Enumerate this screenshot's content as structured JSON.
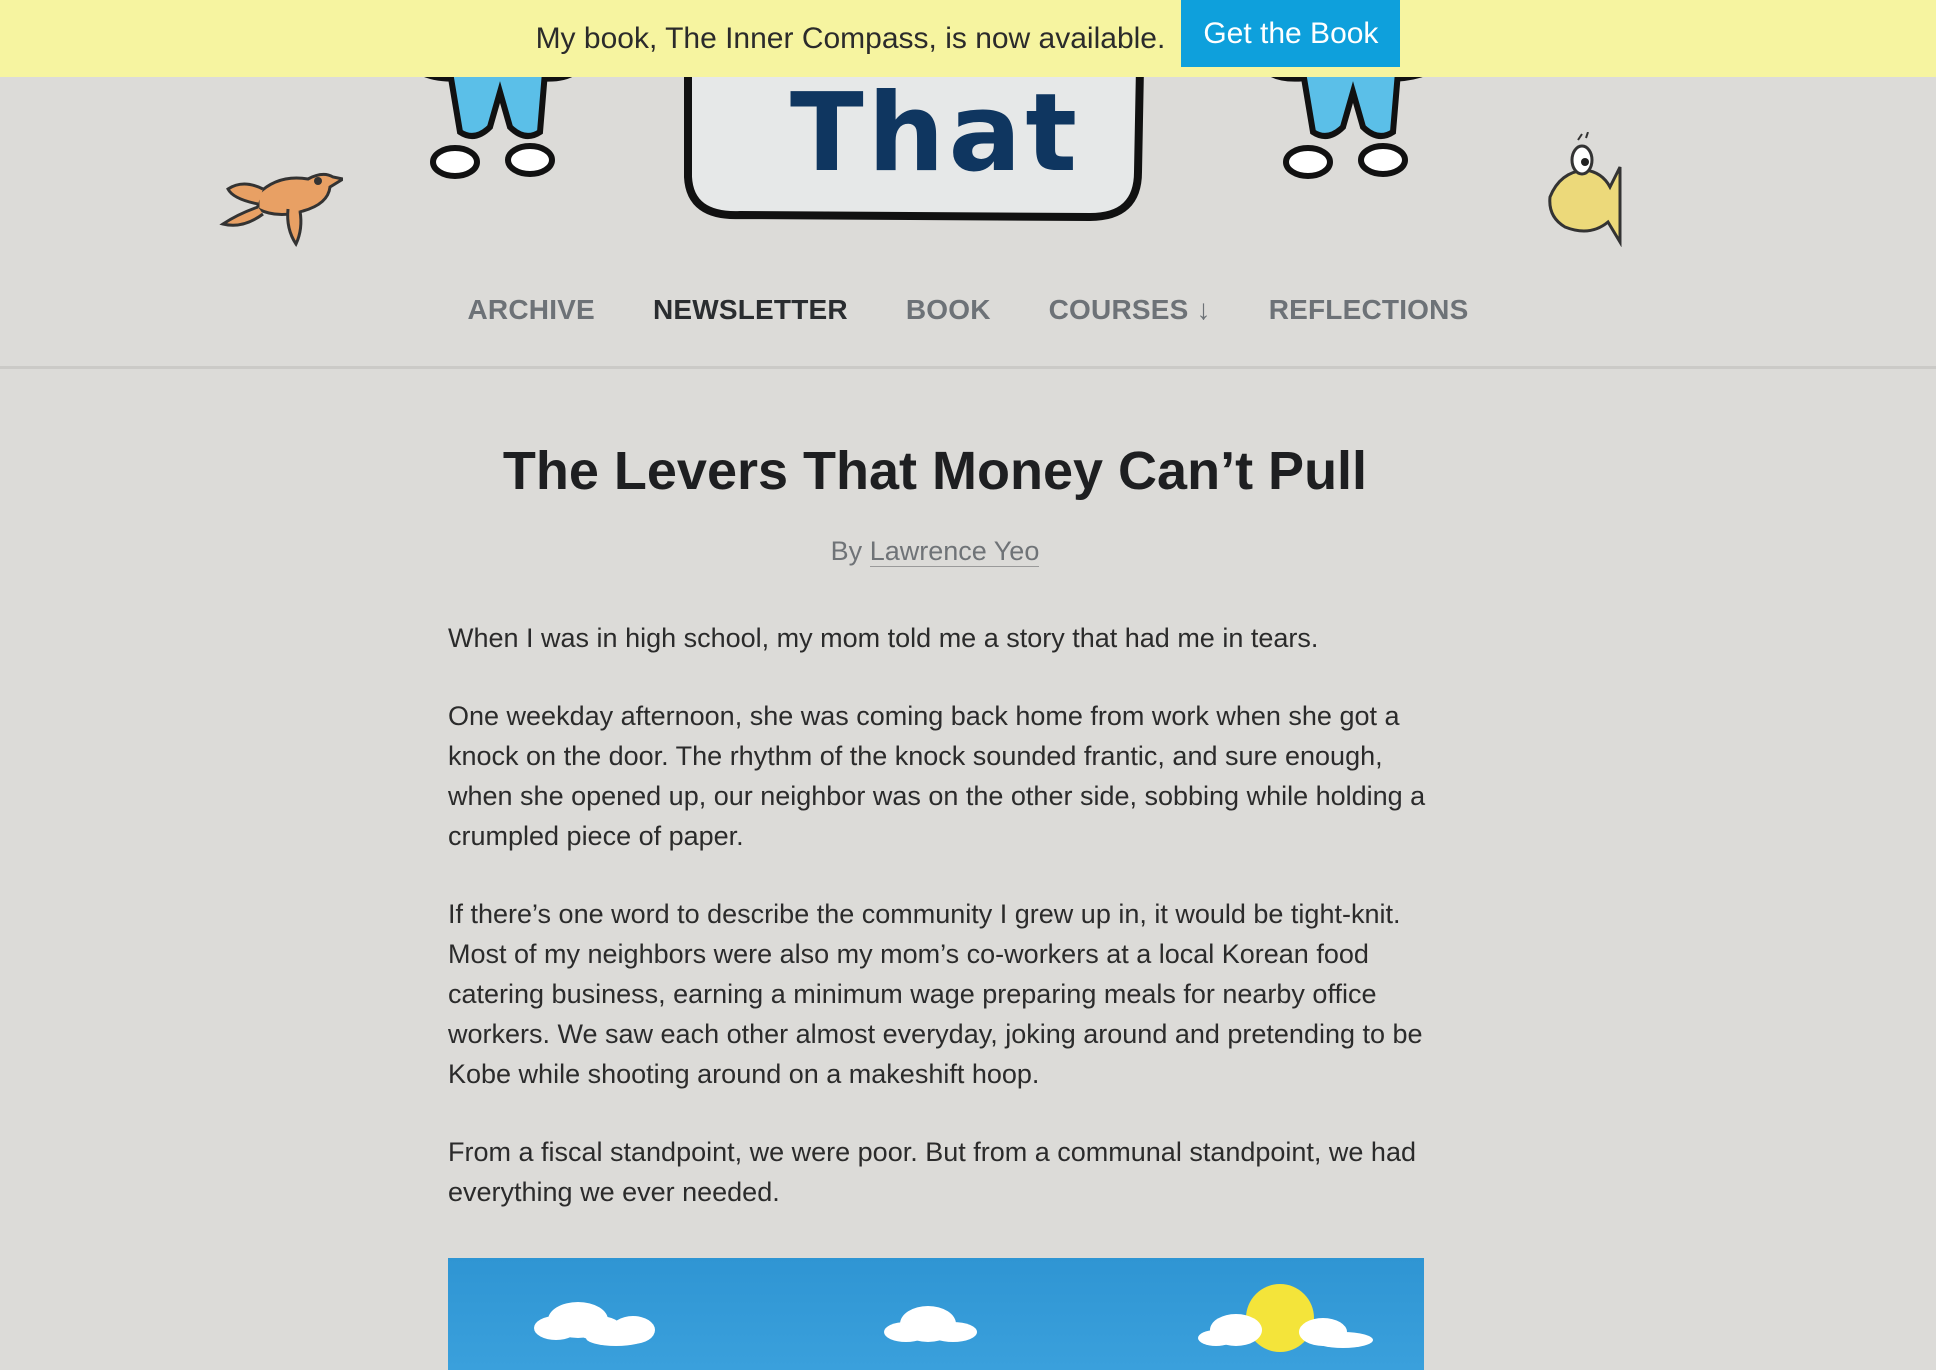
{
  "banner": {
    "text": "My book, The Inner Compass, is now available.",
    "button_label": "Get the Book"
  },
  "header": {
    "logo_text": "That"
  },
  "nav": {
    "items": [
      {
        "label": "ARCHIVE"
      },
      {
        "label": "NEWSLETTER"
      },
      {
        "label": "BOOK"
      },
      {
        "label": "COURSES ↓"
      },
      {
        "label": "REFLECTIONS"
      }
    ]
  },
  "article": {
    "title": "The Levers That Money Can’t Pull",
    "byline_prefix": "By",
    "author": "Lawrence Yeo",
    "paragraphs": [
      "When I was in high school, my mom told me a story that had me in tears.",
      "One weekday afternoon, she was coming back home from work when she got a knock on the door. The rhythm of the knock sounded frantic, and sure enough, when she opened up, our neighbor was on the other side, sobbing while holding a crumpled piece of paper.",
      "If there’s one word to describe the community I grew up in, it would be tight-knit. Most of my neighbors were also my mom’s co-workers at a local Korean food catering business, earning a minimum wage preparing meals for nearby office workers. We saw each other almost everyday, joking around and pretending to be Kobe while shooting around on a makeshift hoop.",
      "From a fiscal standpoint, we were poor. But from a communal standpoint, we had everything we ever needed."
    ]
  },
  "colors": {
    "banner_bg": "#f6f4a0",
    "button_bg": "#0ea0dc",
    "page_bg": "#dcdbd8",
    "hero_sky": "#3399d6",
    "sun": "#f4e43a"
  }
}
